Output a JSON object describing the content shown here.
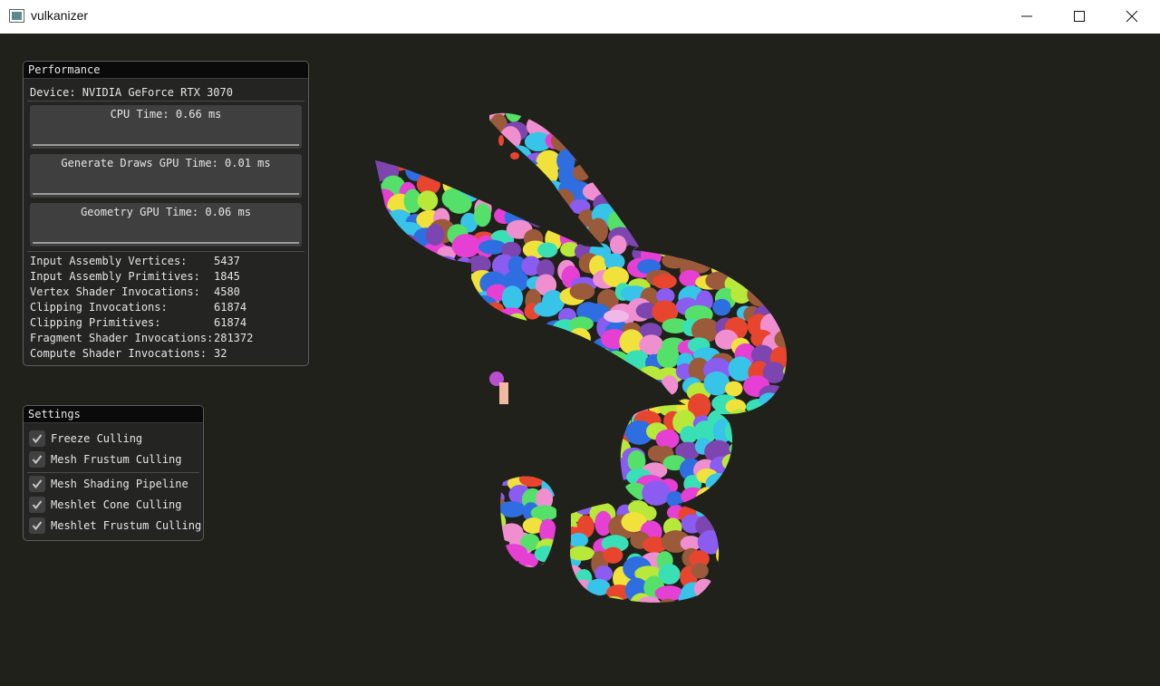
{
  "window": {
    "title": "vulkanizer"
  },
  "performance": {
    "title": "Performance",
    "device_label": "Device: NVIDIA GeForce RTX 3070",
    "plots": [
      {
        "label": "CPU Time: 0.66 ms"
      },
      {
        "label": "Generate Draws GPU Time: 0.01 ms"
      },
      {
        "label": "Geometry GPU Time: 0.06 ms"
      }
    ],
    "stats": [
      {
        "label": "Input Assembly Vertices:",
        "value": "5437"
      },
      {
        "label": "Input Assembly Primitives:",
        "value": "1845"
      },
      {
        "label": "Vertex Shader Invocations:",
        "value": "4580"
      },
      {
        "label": "Clipping Invocations:",
        "value": "61874"
      },
      {
        "label": "Clipping Primitives:",
        "value": "61874"
      },
      {
        "label": "Fragment Shader Invocations:",
        "value": "281372"
      },
      {
        "label": "Compute Shader Invocations:",
        "value": "32"
      }
    ]
  },
  "settings": {
    "title": "Settings",
    "options": [
      {
        "label": "Freeze Culling",
        "checked": true
      },
      {
        "label": "Mesh Frustum Culling",
        "checked": true
      },
      {
        "label": "Mesh Shading Pipeline",
        "checked": true
      },
      {
        "label": "Meshlet Cone Culling",
        "checked": true
      },
      {
        "label": "Meshlet Frustum Culling",
        "checked": true
      }
    ]
  },
  "colors": {
    "background": "#21211c",
    "panel": "#242424",
    "plot_bg": "#3f3f3f",
    "meshlet_palette": [
      "#e53fd4",
      "#38c3e8",
      "#55e06a",
      "#8a5cf0",
      "#f0e23a",
      "#e8452f",
      "#2f6ee0",
      "#9b5a3a",
      "#3ae0b5",
      "#f08fd0",
      "#b8e83a",
      "#7d45b0"
    ]
  }
}
